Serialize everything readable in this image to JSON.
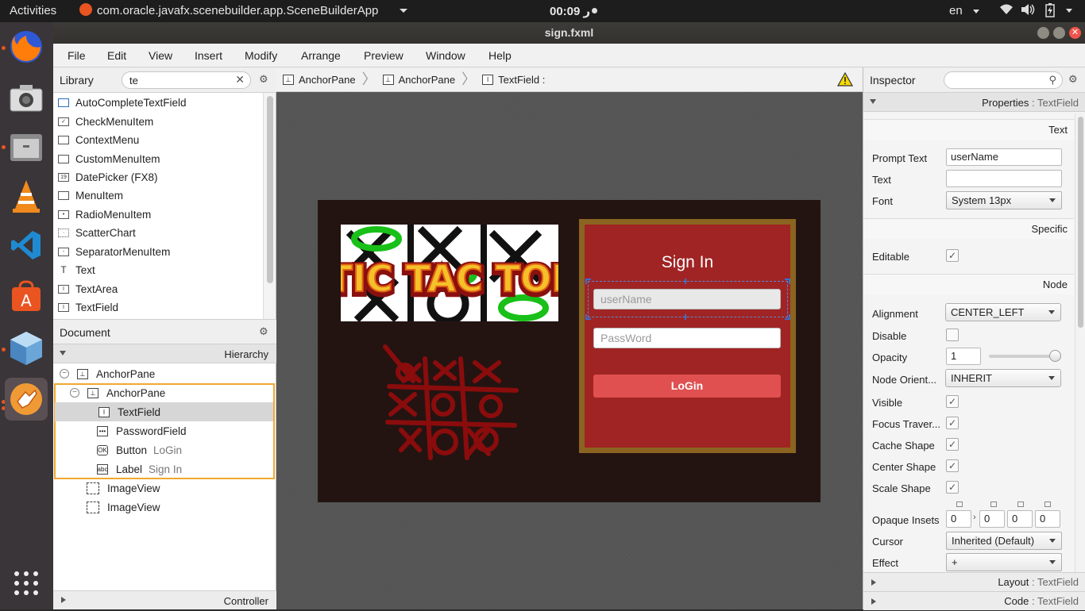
{
  "topbar": {
    "activities": "Activities",
    "app_name": "com.oracle.javafx.scenebuilder.app.SceneBuilderApp",
    "clock": "00:09 ر",
    "lang": "en"
  },
  "window": {
    "title": "sign.fxml"
  },
  "menu": [
    "File",
    "Edit",
    "View",
    "Insert",
    "Modify",
    "Arrange",
    "Preview",
    "Window",
    "Help"
  ],
  "library": {
    "title": "Library",
    "search_value": "te",
    "items": [
      {
        "label": "AutoCompleteTextField",
        "icon": "textfield-icon"
      },
      {
        "label": "CheckMenuItem",
        "icon": "checkmenuitem-icon"
      },
      {
        "label": "ContextMenu",
        "icon": "contextmenu-icon"
      },
      {
        "label": "CustomMenuItem",
        "icon": "custommenuitem-icon"
      },
      {
        "label": "DatePicker  (FX8)",
        "icon": "datepicker-icon"
      },
      {
        "label": "MenuItem",
        "icon": "menuitem-icon"
      },
      {
        "label": "RadioMenuItem",
        "icon": "radiomenuitem-icon"
      },
      {
        "label": "ScatterChart",
        "icon": "scatterchart-icon"
      },
      {
        "label": "SeparatorMenuItem",
        "icon": "separatormenuitem-icon"
      },
      {
        "label": "Text",
        "icon": "text-icon"
      },
      {
        "label": "TextArea",
        "icon": "textarea-icon"
      },
      {
        "label": "TextField",
        "icon": "textfield-icon"
      }
    ]
  },
  "document": {
    "title": "Document",
    "hierarchy_label": "Hierarchy",
    "rows": [
      {
        "label": "AnchorPane",
        "sub": ""
      },
      {
        "label": "AnchorPane",
        "sub": ""
      },
      {
        "label": "TextField",
        "sub": ""
      },
      {
        "label": "PasswordField",
        "sub": ""
      },
      {
        "label": "Button",
        "sub": "LoGin"
      },
      {
        "label": "Label",
        "sub": "Sign In"
      },
      {
        "label": "ImageView",
        "sub": ""
      },
      {
        "label": "ImageView",
        "sub": ""
      }
    ],
    "controller_label": "Controller"
  },
  "breadcrumb": [
    "AnchorPane",
    "AnchorPane",
    "TextField :"
  ],
  "design": {
    "logo_text": "TIC TAC TOE",
    "sign_in_title": "Sign In",
    "username_placeholder": "userName",
    "password_placeholder": "PassWord",
    "login_button": "LoGin"
  },
  "inspector": {
    "title": "Inspector",
    "properties_header": "Properties",
    "properties_target": ": TextField",
    "sections": {
      "text": "Text",
      "specific": "Specific",
      "node": "Node"
    },
    "labels": {
      "prompt_text": "Prompt Text",
      "text": "Text",
      "font": "Font",
      "editable": "Editable",
      "alignment": "Alignment",
      "disable": "Disable",
      "opacity": "Opacity",
      "node_orient": "Node Orient...",
      "visible": "Visible",
      "focus_trav": "Focus Traver...",
      "cache_shape": "Cache Shape",
      "center_shape": "Center Shape",
      "scale_shape": "Scale Shape",
      "opaque_insets": "Opaque Insets",
      "cursor": "Cursor",
      "effect": "Effect"
    },
    "values": {
      "prompt_text": "userName",
      "text": "",
      "font": "System 13px",
      "alignment": "CENTER_LEFT",
      "opacity": "1",
      "opacity_level": 1.0,
      "node_orient": "INHERIT",
      "cursor": "Inherited (Default)",
      "effect": "+",
      "insets": [
        "0",
        "0",
        "0",
        "0"
      ]
    },
    "checks": {
      "editable": true,
      "disable": false,
      "visible": true,
      "focus_trav": true,
      "cache_shape": true,
      "center_shape": true,
      "scale_shape": true
    },
    "layout_footer": "Layout",
    "code_footer": "Code",
    "footer_target": ": TextField"
  },
  "colors": {
    "accent": "#e95420",
    "form_bg": "#a02424",
    "form_border": "#8a6420",
    "login_btn": "#e05050",
    "canvas_bg": "#231412",
    "selection": "#f0a830"
  }
}
